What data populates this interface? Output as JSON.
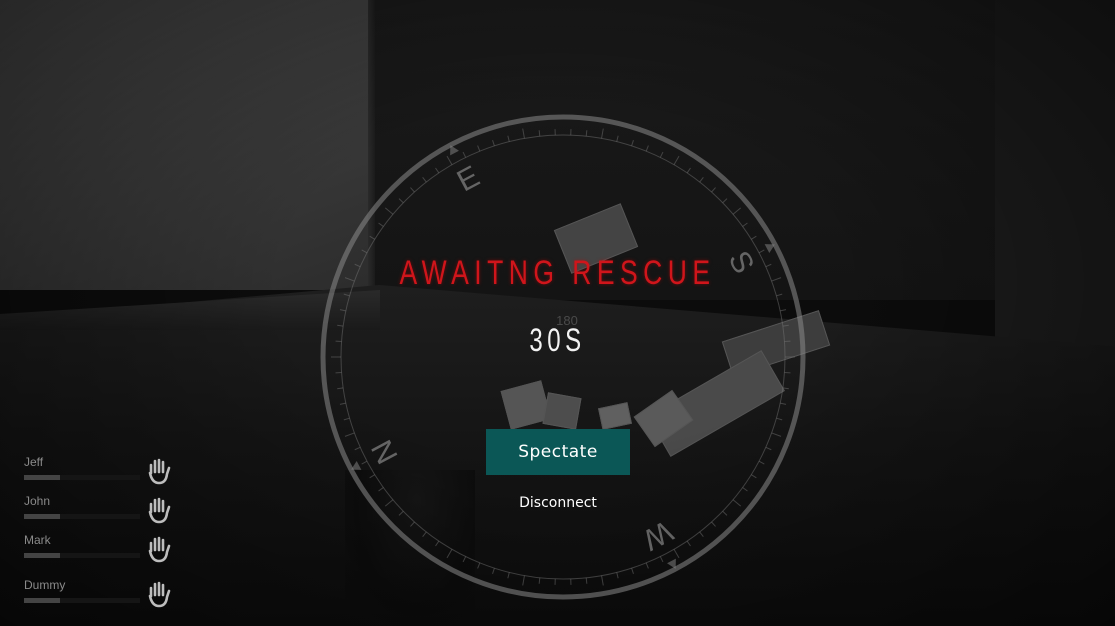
{
  "status": {
    "title": "AWAITNG RESCUE",
    "timer": "30S"
  },
  "actions": {
    "spectate_label": "Spectate",
    "disconnect_label": "Disconnect"
  },
  "compass": {
    "directions": [
      "E",
      "S",
      "W",
      "N"
    ],
    "inner_readout": "180"
  },
  "players": [
    {
      "name": "Jeff",
      "icon": "hand-icon",
      "health": 0.3
    },
    {
      "name": "John",
      "icon": "hand-icon",
      "health": 0.3
    },
    {
      "name": "Mark",
      "icon": "hand-icon",
      "health": 0.3
    },
    {
      "name": "Dummy",
      "icon": "hand-icon",
      "health": 0.3
    }
  ],
  "colors": {
    "title": "#d0151b",
    "spectate_bg": "#0b5756",
    "text": "#ffffff"
  }
}
